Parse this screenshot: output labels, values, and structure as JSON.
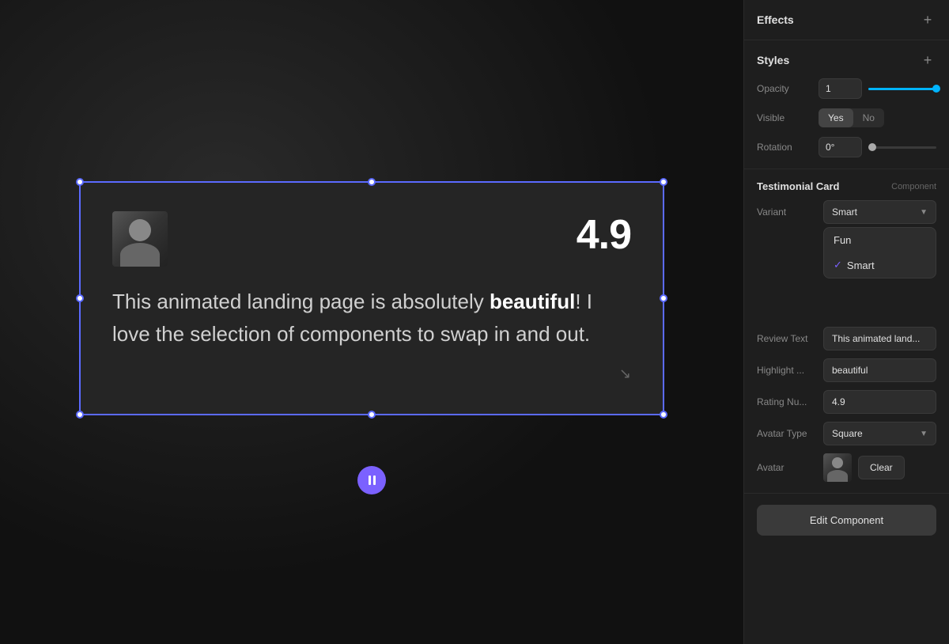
{
  "canvas": {
    "background": "#111111"
  },
  "card": {
    "rating": "4.9",
    "review_text": "This animated landing page is absolutely beautiful! I love the selection of components to swap in and out.",
    "highlight_word": "beautiful"
  },
  "panel": {
    "effects_label": "Effects",
    "styles_label": "Styles",
    "opacity_label": "Opacity",
    "opacity_value": "1",
    "visible_label": "Visible",
    "visible_yes": "Yes",
    "visible_no": "No",
    "rotation_label": "Rotation",
    "rotation_value": "0°",
    "component_title": "Testimonial Card",
    "component_badge": "Component",
    "variant_label": "Variant",
    "variant_option_fun": "Fun",
    "variant_option_smart": "Smart",
    "review_text_label": "Review Text",
    "review_text_value": "This animated land...",
    "highlight_label": "Highlight ...",
    "highlight_value": "beautiful",
    "rating_label": "Rating Nu...",
    "rating_value": "4.9",
    "avatar_type_label": "Avatar Type",
    "avatar_type_value": "Square",
    "avatar_label": "Avatar",
    "clear_label": "Clear",
    "edit_component_label": "Edit Component",
    "add_icon": "+",
    "plus_icon": "+"
  }
}
